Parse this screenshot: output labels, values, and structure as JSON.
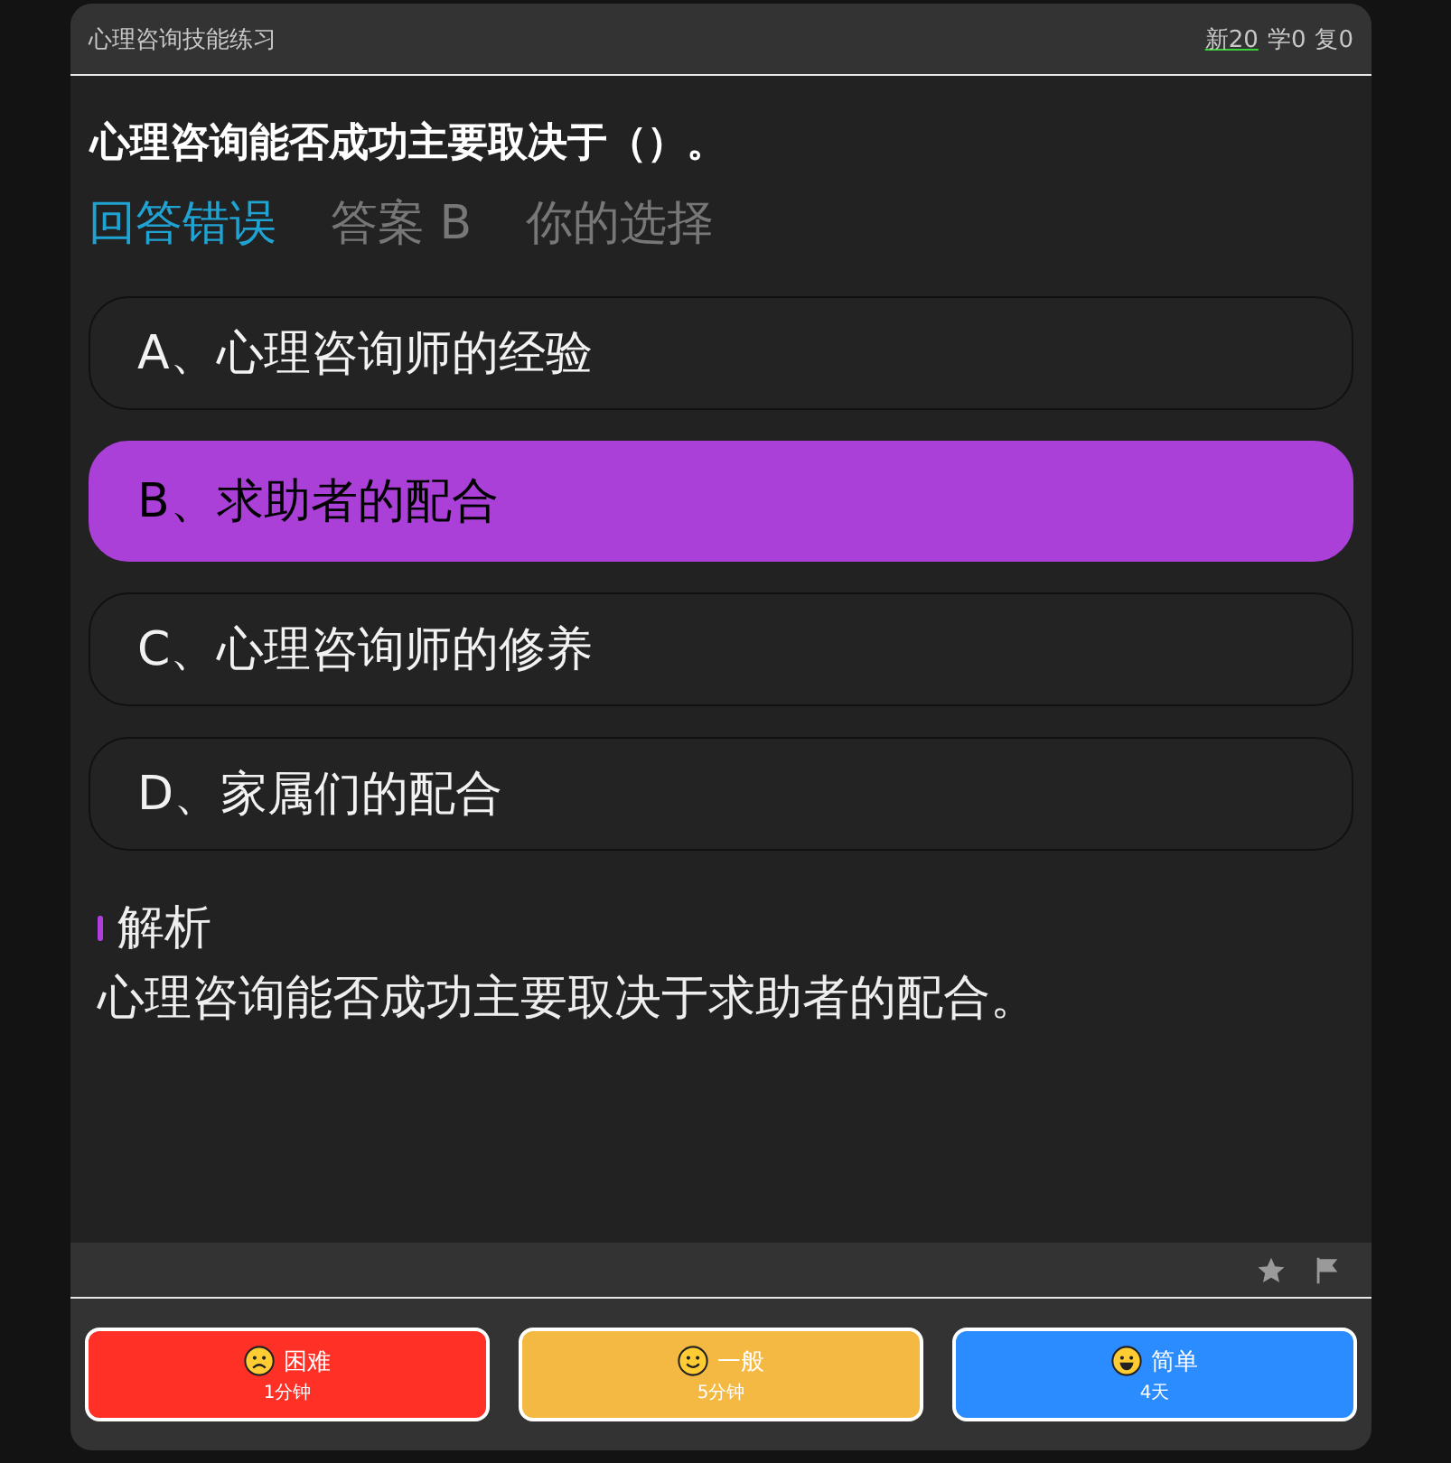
{
  "header": {
    "title": "心理咨询技能练习",
    "counters": [
      {
        "label": "新20",
        "selected": true
      },
      {
        "label": "学0",
        "selected": false
      },
      {
        "label": "复0",
        "selected": false
      }
    ]
  },
  "question": {
    "text": "心理咨询能否成功主要取决于（）。"
  },
  "result": {
    "verdict": "回答错误",
    "correct": false,
    "answer": "答案 B",
    "note": "你的选择"
  },
  "options": [
    {
      "text": "A、心理咨询师的经验",
      "selected": false
    },
    {
      "text": "B、求助者的配合",
      "selected": true
    },
    {
      "text": "C、心理咨询师的修养",
      "selected": false
    },
    {
      "text": "D、家属们的配合",
      "selected": false
    }
  ],
  "analysis": {
    "heading": "解析",
    "text": "心理咨询能否成功主要取决于求助者的配合。"
  },
  "toolbar": {
    "starred": false,
    "flagged": false
  },
  "ease_buttons": [
    {
      "kind": "hard",
      "label": "困难",
      "interval": "1分钟"
    },
    {
      "kind": "good",
      "label": "一般",
      "interval": "5分钟"
    },
    {
      "kind": "easy",
      "label": "简单",
      "interval": "4天"
    }
  ]
}
